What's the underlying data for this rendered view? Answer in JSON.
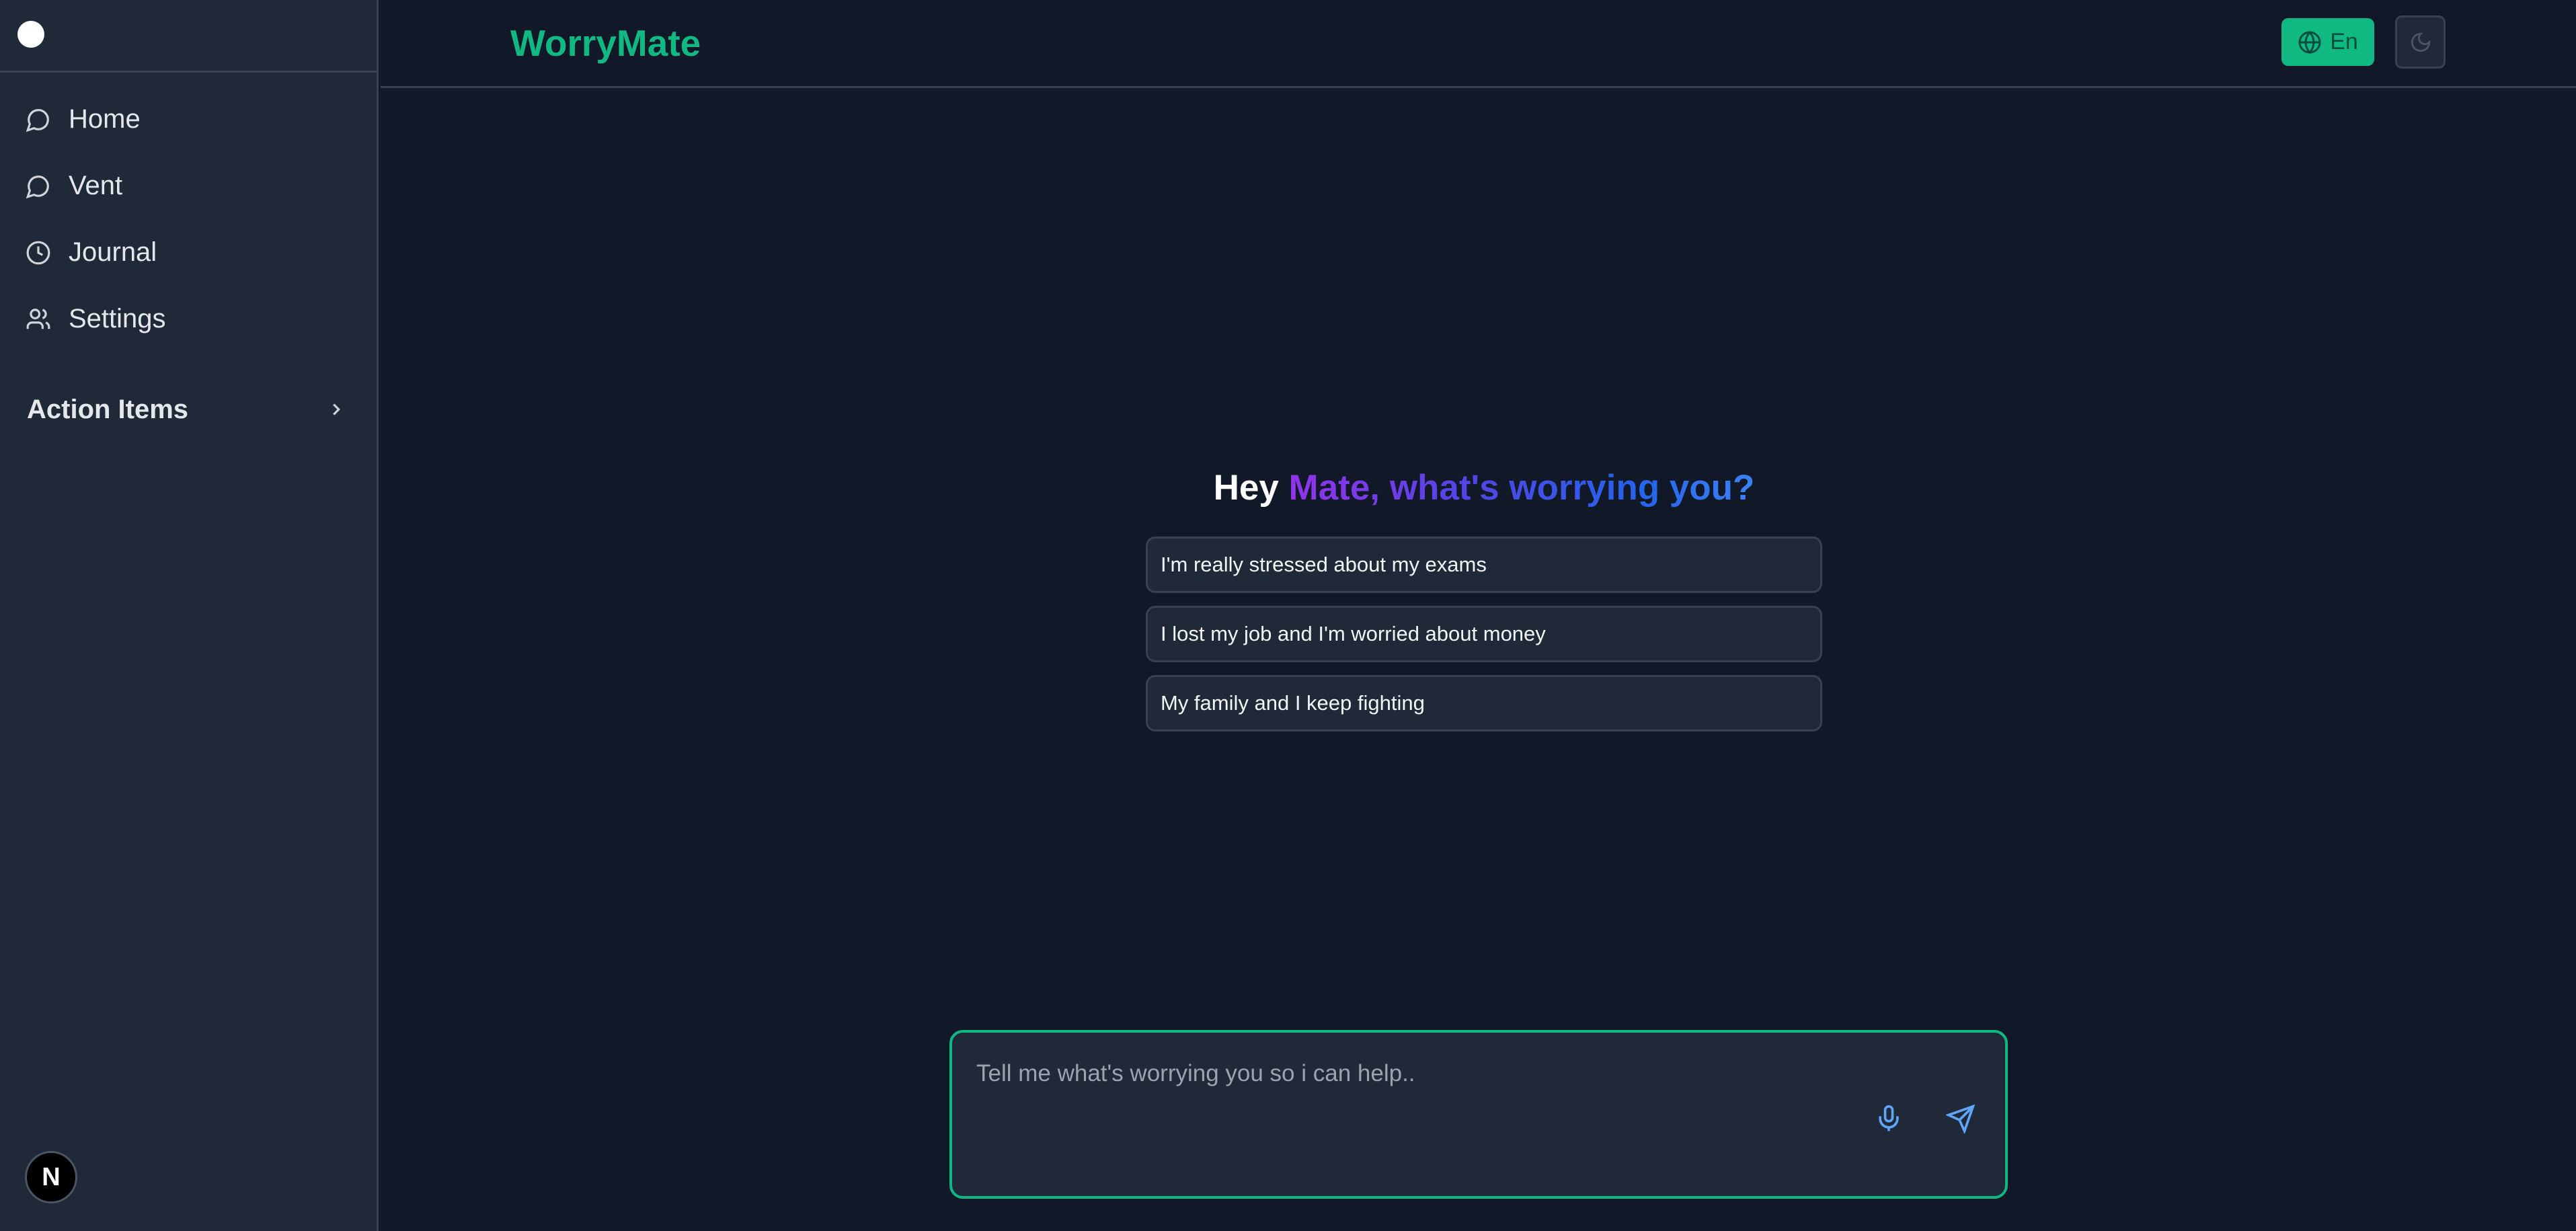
{
  "sidebar": {
    "items": [
      {
        "label": "Home",
        "icon": "message-circle-icon"
      },
      {
        "label": "Vent",
        "icon": "message-circle-icon"
      },
      {
        "label": "Journal",
        "icon": "clock-icon"
      },
      {
        "label": "Settings",
        "icon": "users-icon"
      }
    ],
    "section_label": "Action Items",
    "badge_text": "N"
  },
  "header": {
    "title": "WorryMate",
    "lang_label": "En",
    "theme_icon": "moon-icon"
  },
  "main": {
    "greeting_hey": "Hey",
    "greeting_rest": "Mate, what's worrying you?",
    "suggestions": [
      "I'm really stressed about my exams",
      "I lost my job and I'm worried about money",
      "My family and I keep fighting"
    ]
  },
  "composer": {
    "placeholder": "Tell me what's worrying you so i can help..",
    "value": ""
  },
  "colors": {
    "background": "#111827",
    "sidebar": "#1f2937",
    "accent": "#10b981",
    "gradient_start": "#9333ea",
    "gradient_end": "#3b82f6",
    "icon_blue": "#60a5fa"
  }
}
